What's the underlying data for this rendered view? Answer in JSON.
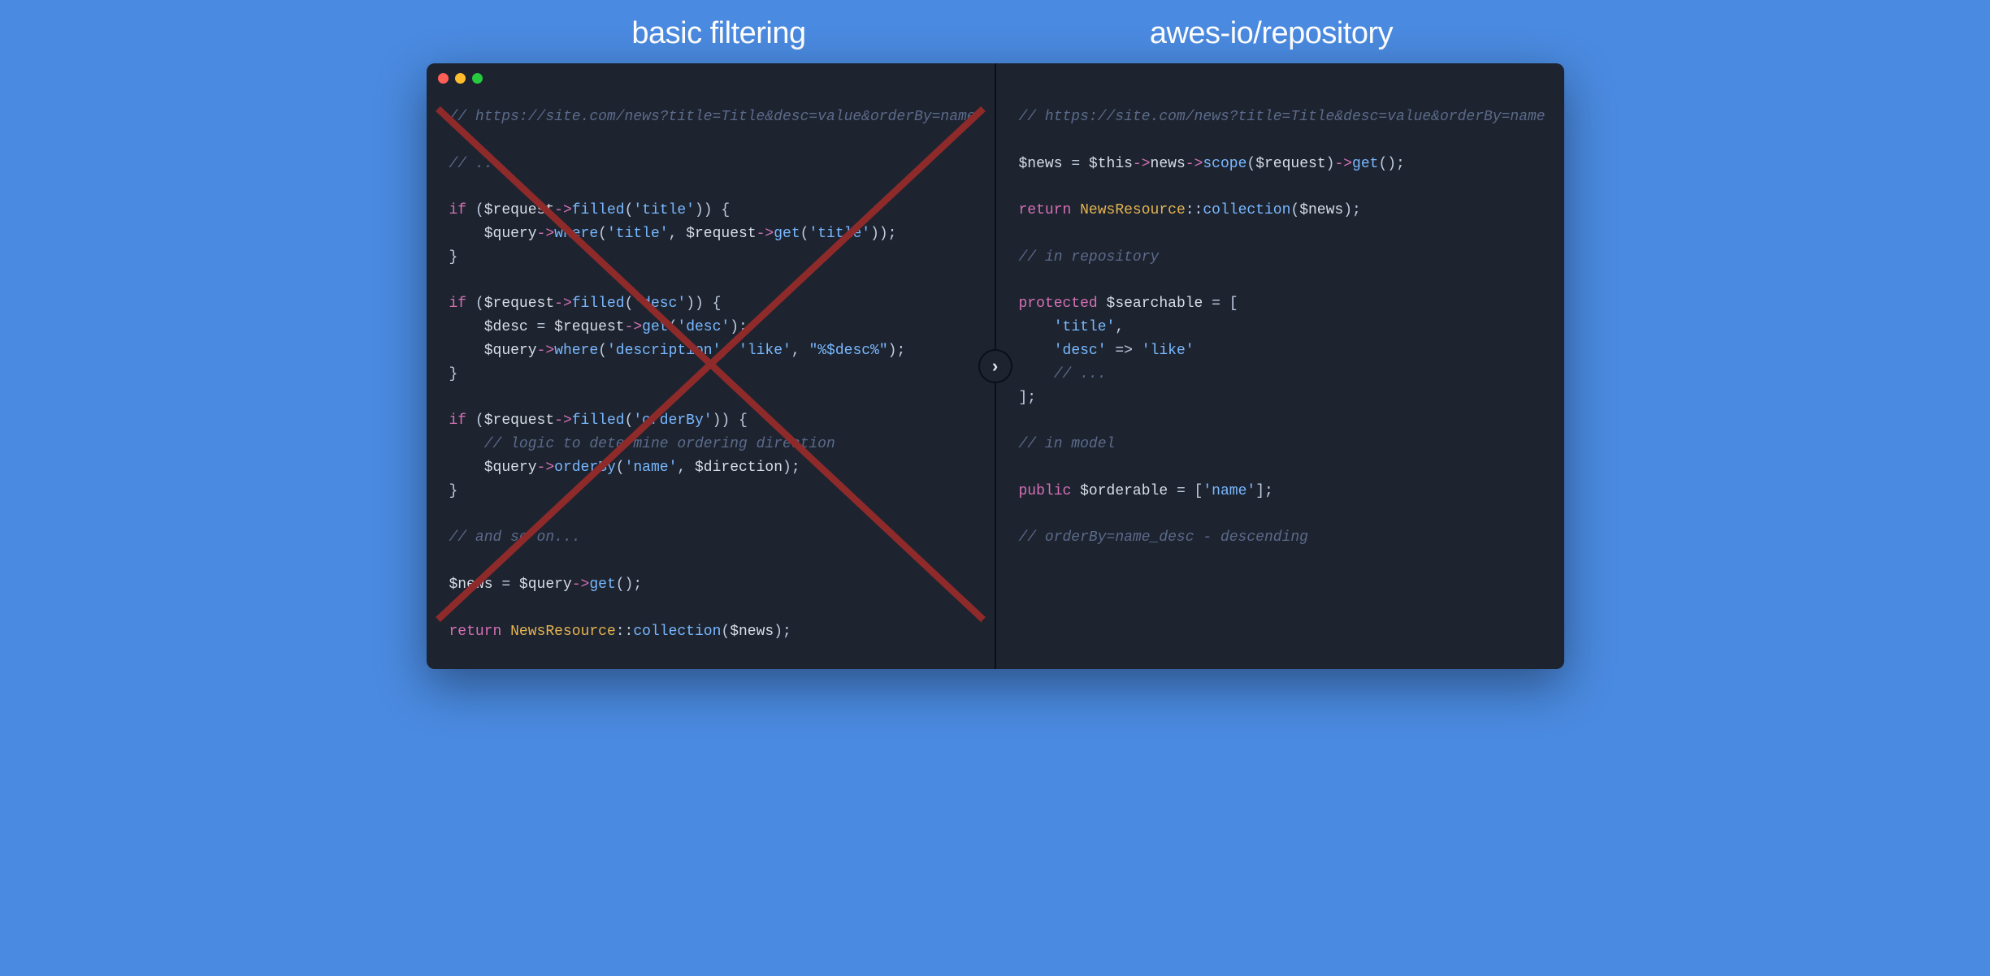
{
  "headings": {
    "left": "basic filtering",
    "right": "awes-io/repository"
  },
  "divider_glyph": "›",
  "traffic_lights": [
    "close",
    "minimize",
    "zoom"
  ],
  "left_code": {
    "url_comment": "// https://site.com/news?title=Title&desc=value&orderBy=name",
    "ellipsis_comment": "// ...",
    "if1_if": "if",
    "if1_var": "$request",
    "if1_arrow": "->",
    "if1_fn": "filled",
    "if1_open_paren": "(",
    "if1_arg": "'title'",
    "if1_close": ")) {",
    "if1_body_var": "$query",
    "if1_body_fn": "where",
    "if1_body_arg1": "'title'",
    "if1_body_comma": ", ",
    "if1_body_var2": "$request",
    "if1_body_fn2": "get",
    "if1_body_arg2": "'title'",
    "if1_body_tail": "));",
    "brace_close": "}",
    "if2_arg": "'desc'",
    "if2_desc_var": "$desc",
    "if2_eq": " = ",
    "if2_get_arg": "'desc'",
    "if2_tail1": ");",
    "if2_where_arg1": "'description'",
    "if2_where_arg2": "'like'",
    "if2_where_arg3": "\"%$desc%\"",
    "if3_arg": "'orderBy'",
    "if3_comment": "// logic to determine ordering direction",
    "if3_orderby_fn": "orderBy",
    "if3_orderby_arg1": "'name'",
    "if3_direction": "$direction",
    "and_so_on": "// and so on...",
    "news_var": "$news",
    "news_get": "get",
    "news_tail": "();",
    "return_kw": "return",
    "return_class": "NewsResource",
    "return_fn": "collection",
    "return_arg": "$news",
    "return_tail": ");",
    "dcolon": "::"
  },
  "right_code": {
    "url_comment": "// https://site.com/news?title=Title&desc=value&orderBy=name",
    "news_var": "$news",
    "eq": " = ",
    "this": "$this",
    "arrow": "->",
    "news_prop": "news",
    "scope_fn": "scope",
    "scope_arg": "$request",
    "get_fn": "get",
    "tail_semi": "();",
    "scope_tail": ")",
    "return_kw": "return",
    "return_class": "NewsResource",
    "dcolon": "::",
    "return_fn": "collection",
    "return_arg": "$news",
    "return_tail": ");",
    "in_repo_comment": "// in repository",
    "protected_kw": "protected",
    "searchable_var": "$searchable",
    "arr_open": " = [",
    "arr_item1": "'title'",
    "comma": ",",
    "arr_item2_key": "'desc'",
    "fat_arrow": " => ",
    "arr_item2_val": "'like'",
    "arr_ellipsis": "// ...",
    "arr_close": "];",
    "in_model_comment": "// in model",
    "public_kw": "public",
    "orderable_var": "$orderable",
    "orderable_eq": " = [",
    "orderable_item": "'name'",
    "orderable_close": "];",
    "orderby_comment": "// orderBy=name_desc - descending"
  }
}
